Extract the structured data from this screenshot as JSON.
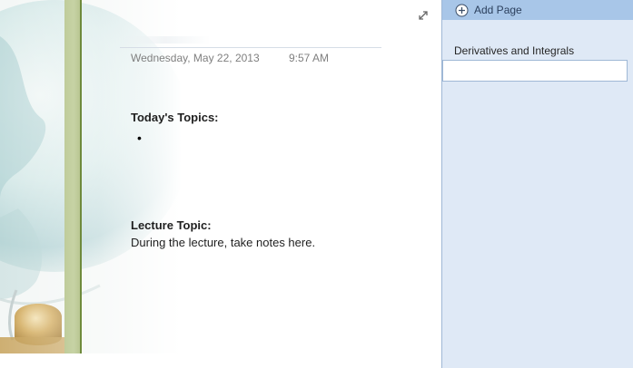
{
  "page": {
    "date": "Wednesday, May 22, 2013",
    "time": "9:57 AM",
    "sections": [
      {
        "heading": "Today's Topics:",
        "bullets": [
          ""
        ]
      },
      {
        "heading": "Lecture Topic:",
        "body": "During the lecture, take notes here."
      }
    ]
  },
  "page_pane": {
    "add_page_label": "Add Page",
    "pages": [
      {
        "label": "Derivatives and Integrals"
      }
    ]
  },
  "colors": {
    "page_pane_bg": "#dfe9f6",
    "add_page_bar": "#a8c6e8",
    "margin_stripe": "#c7d3a5",
    "margin_line": "#6e8a3c"
  }
}
